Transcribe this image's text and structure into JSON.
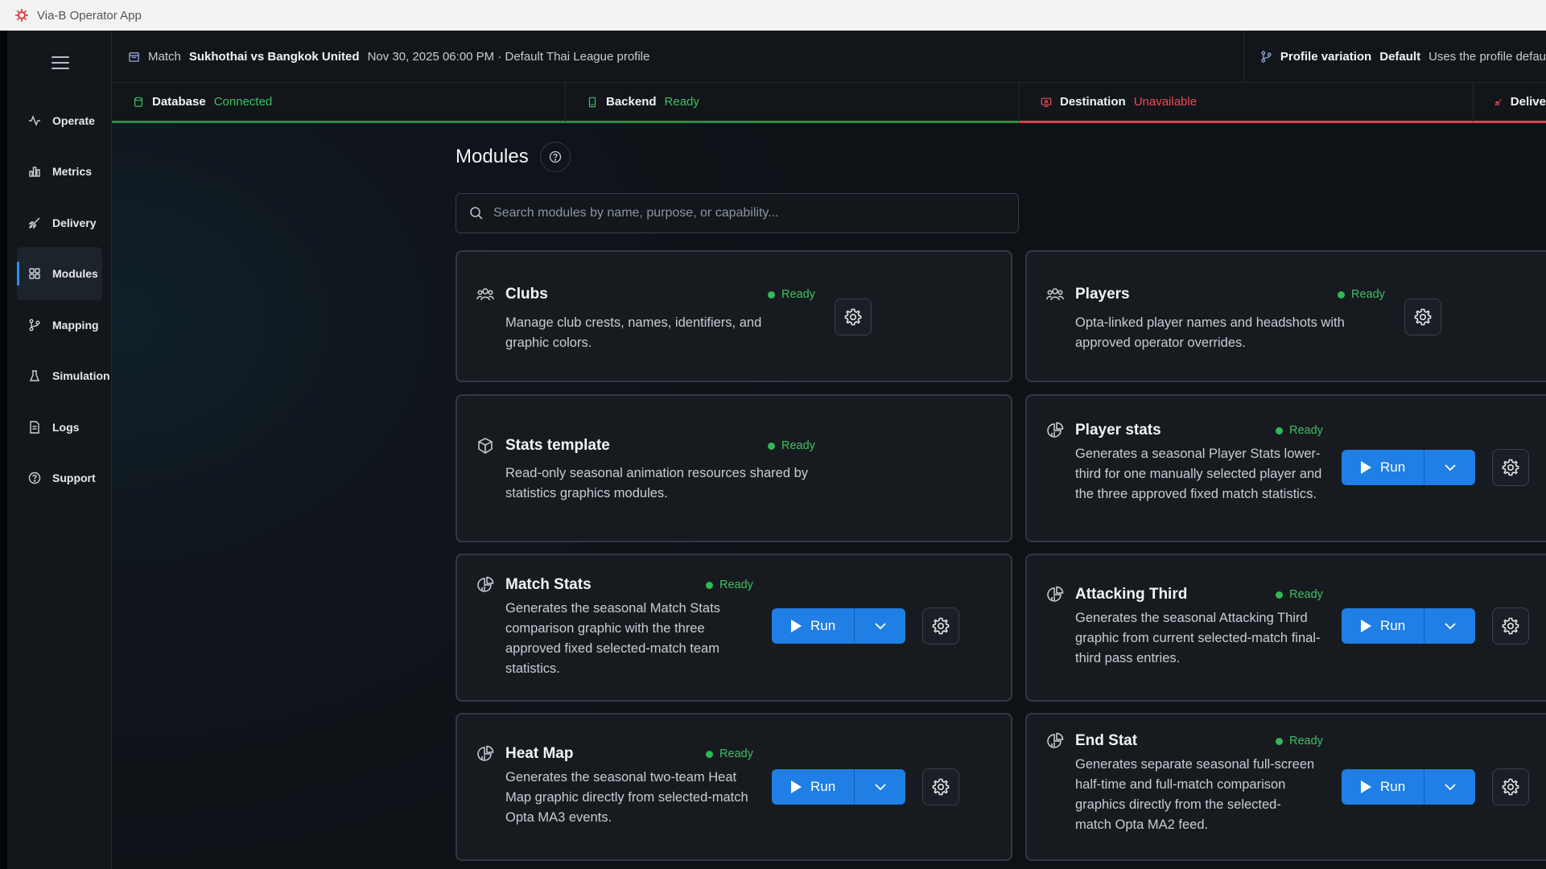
{
  "window": {
    "title": "Via-B Operator App"
  },
  "sidebar": {
    "items": [
      {
        "label": "Operate",
        "icon": "activity-icon"
      },
      {
        "label": "Metrics",
        "icon": "bar-chart-icon"
      },
      {
        "label": "Delivery",
        "icon": "rocket-icon"
      },
      {
        "label": "Modules",
        "icon": "grid-icon",
        "active": true
      },
      {
        "label": "Mapping",
        "icon": "branch-icon"
      },
      {
        "label": "Simulation",
        "icon": "flask-icon"
      },
      {
        "label": "Logs",
        "icon": "document-icon"
      },
      {
        "label": "Support",
        "icon": "help-circle-icon"
      }
    ]
  },
  "match": {
    "label": "Match",
    "name": "Sukhothai vs Bangkok United",
    "details": "Nov 30, 2025 06:00 PM · Default Thai League profile"
  },
  "profile": {
    "label": "Profile variation",
    "value": "Default",
    "description": "Uses the profile defau"
  },
  "status": {
    "database": {
      "label": "Database",
      "value": "Connected",
      "color": "#3fbf62"
    },
    "backend": {
      "label": "Backend",
      "value": "Ready",
      "color": "#3fbf62"
    },
    "destination": {
      "label": "Destination",
      "value": "Unavailable",
      "color": "#ef4b55"
    },
    "delivery": {
      "label": "Delive"
    }
  },
  "modules": {
    "title": "Modules",
    "search_placeholder": "Search modules by name, purpose, or capability...",
    "run_label": "Run",
    "cards": [
      {
        "name": "Clubs",
        "status": "Ready",
        "description": "Manage club crests, names, identifiers, and graphic colors."
      },
      {
        "name": "Players",
        "status": "Ready",
        "description": "Opta-linked player names and headshots with approved operator overrides."
      },
      {
        "name": "Stats template",
        "status": "Ready",
        "description": "Read-only seasonal animation resources shared by statistics graphics modules."
      },
      {
        "name": "Player stats",
        "status": "Ready",
        "description": "Generates a seasonal Player Stats lower-third for one manually selected player and the three approved fixed match statistics."
      },
      {
        "name": "Match Stats",
        "status": "Ready",
        "description": "Generates the seasonal Match Stats comparison graphic with the three approved fixed selected-match team statistics."
      },
      {
        "name": "Attacking Third",
        "status": "Ready",
        "description": "Generates the seasonal Attacking Third graphic from current selected-match final-third pass entries."
      },
      {
        "name": "Heat Map",
        "status": "Ready",
        "description": "Generates the seasonal two-team Heat Map graphic directly from selected-match Opta MA3 events."
      },
      {
        "name": "End Stat",
        "status": "Ready",
        "description": "Generates separate seasonal full-screen half-time and full-match comparison graphics directly from the selected-match Opta MA2 feed."
      }
    ]
  },
  "colors": {
    "accent": "#1f7fe5",
    "ok": "#3fbf62",
    "error": "#ef4b55",
    "background": "#0e1217"
  }
}
